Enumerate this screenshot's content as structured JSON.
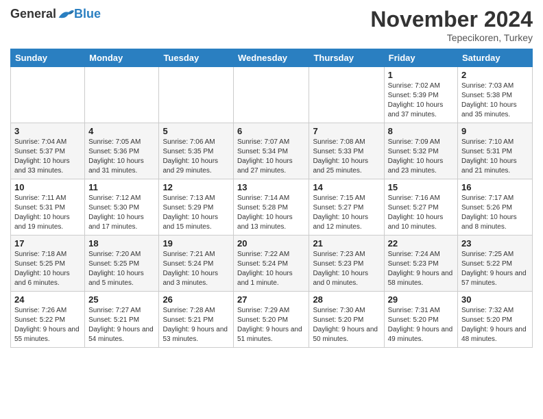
{
  "header": {
    "logo_general": "General",
    "logo_blue": "Blue",
    "month_title": "November 2024",
    "location": "Tepecikoren, Turkey"
  },
  "days_of_week": [
    "Sunday",
    "Monday",
    "Tuesday",
    "Wednesday",
    "Thursday",
    "Friday",
    "Saturday"
  ],
  "weeks": [
    [
      {
        "day": "",
        "info": ""
      },
      {
        "day": "",
        "info": ""
      },
      {
        "day": "",
        "info": ""
      },
      {
        "day": "",
        "info": ""
      },
      {
        "day": "",
        "info": ""
      },
      {
        "day": "1",
        "info": "Sunrise: 7:02 AM\nSunset: 5:39 PM\nDaylight: 10 hours and 37 minutes."
      },
      {
        "day": "2",
        "info": "Sunrise: 7:03 AM\nSunset: 5:38 PM\nDaylight: 10 hours and 35 minutes."
      }
    ],
    [
      {
        "day": "3",
        "info": "Sunrise: 7:04 AM\nSunset: 5:37 PM\nDaylight: 10 hours and 33 minutes."
      },
      {
        "day": "4",
        "info": "Sunrise: 7:05 AM\nSunset: 5:36 PM\nDaylight: 10 hours and 31 minutes."
      },
      {
        "day": "5",
        "info": "Sunrise: 7:06 AM\nSunset: 5:35 PM\nDaylight: 10 hours and 29 minutes."
      },
      {
        "day": "6",
        "info": "Sunrise: 7:07 AM\nSunset: 5:34 PM\nDaylight: 10 hours and 27 minutes."
      },
      {
        "day": "7",
        "info": "Sunrise: 7:08 AM\nSunset: 5:33 PM\nDaylight: 10 hours and 25 minutes."
      },
      {
        "day": "8",
        "info": "Sunrise: 7:09 AM\nSunset: 5:32 PM\nDaylight: 10 hours and 23 minutes."
      },
      {
        "day": "9",
        "info": "Sunrise: 7:10 AM\nSunset: 5:31 PM\nDaylight: 10 hours and 21 minutes."
      }
    ],
    [
      {
        "day": "10",
        "info": "Sunrise: 7:11 AM\nSunset: 5:31 PM\nDaylight: 10 hours and 19 minutes."
      },
      {
        "day": "11",
        "info": "Sunrise: 7:12 AM\nSunset: 5:30 PM\nDaylight: 10 hours and 17 minutes."
      },
      {
        "day": "12",
        "info": "Sunrise: 7:13 AM\nSunset: 5:29 PM\nDaylight: 10 hours and 15 minutes."
      },
      {
        "day": "13",
        "info": "Sunrise: 7:14 AM\nSunset: 5:28 PM\nDaylight: 10 hours and 13 minutes."
      },
      {
        "day": "14",
        "info": "Sunrise: 7:15 AM\nSunset: 5:27 PM\nDaylight: 10 hours and 12 minutes."
      },
      {
        "day": "15",
        "info": "Sunrise: 7:16 AM\nSunset: 5:27 PM\nDaylight: 10 hours and 10 minutes."
      },
      {
        "day": "16",
        "info": "Sunrise: 7:17 AM\nSunset: 5:26 PM\nDaylight: 10 hours and 8 minutes."
      }
    ],
    [
      {
        "day": "17",
        "info": "Sunrise: 7:18 AM\nSunset: 5:25 PM\nDaylight: 10 hours and 6 minutes."
      },
      {
        "day": "18",
        "info": "Sunrise: 7:20 AM\nSunset: 5:25 PM\nDaylight: 10 hours and 5 minutes."
      },
      {
        "day": "19",
        "info": "Sunrise: 7:21 AM\nSunset: 5:24 PM\nDaylight: 10 hours and 3 minutes."
      },
      {
        "day": "20",
        "info": "Sunrise: 7:22 AM\nSunset: 5:24 PM\nDaylight: 10 hours and 1 minute."
      },
      {
        "day": "21",
        "info": "Sunrise: 7:23 AM\nSunset: 5:23 PM\nDaylight: 10 hours and 0 minutes."
      },
      {
        "day": "22",
        "info": "Sunrise: 7:24 AM\nSunset: 5:23 PM\nDaylight: 9 hours and 58 minutes."
      },
      {
        "day": "23",
        "info": "Sunrise: 7:25 AM\nSunset: 5:22 PM\nDaylight: 9 hours and 57 minutes."
      }
    ],
    [
      {
        "day": "24",
        "info": "Sunrise: 7:26 AM\nSunset: 5:22 PM\nDaylight: 9 hours and 55 minutes."
      },
      {
        "day": "25",
        "info": "Sunrise: 7:27 AM\nSunset: 5:21 PM\nDaylight: 9 hours and 54 minutes."
      },
      {
        "day": "26",
        "info": "Sunrise: 7:28 AM\nSunset: 5:21 PM\nDaylight: 9 hours and 53 minutes."
      },
      {
        "day": "27",
        "info": "Sunrise: 7:29 AM\nSunset: 5:20 PM\nDaylight: 9 hours and 51 minutes."
      },
      {
        "day": "28",
        "info": "Sunrise: 7:30 AM\nSunset: 5:20 PM\nDaylight: 9 hours and 50 minutes."
      },
      {
        "day": "29",
        "info": "Sunrise: 7:31 AM\nSunset: 5:20 PM\nDaylight: 9 hours and 49 minutes."
      },
      {
        "day": "30",
        "info": "Sunrise: 7:32 AM\nSunset: 5:20 PM\nDaylight: 9 hours and 48 minutes."
      }
    ]
  ]
}
